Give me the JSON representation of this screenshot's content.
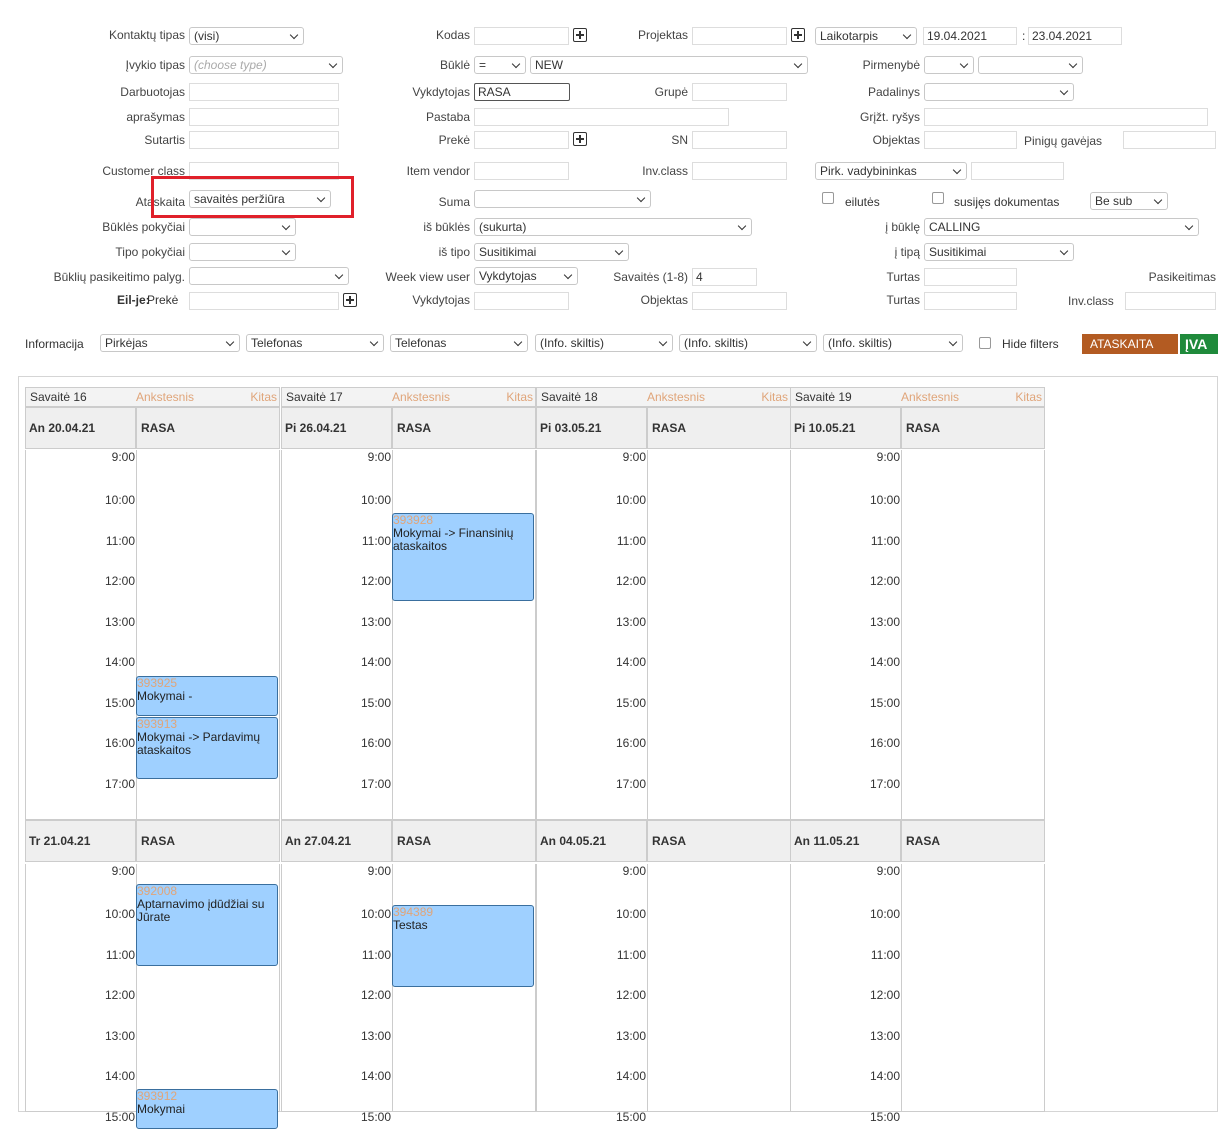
{
  "filters": {
    "kontaktu_tipas": {
      "label": "Kontaktų tipas",
      "value": "(visi)"
    },
    "ivykio_tipas": {
      "label": "Įvykio tipas",
      "placeholder": "(choose type)"
    },
    "darbuotojas": {
      "label": "Darbuotojas"
    },
    "aprasymas": {
      "label": "aprašymas"
    },
    "sutartis": {
      "label": "Sutartis"
    },
    "customer_class": {
      "label": "Customer class"
    },
    "ataskaita": {
      "label": "Ataskaita",
      "value": "savaitės peržiūra"
    },
    "bukles_pokyciai": {
      "label": "Būklės pokyčiai"
    },
    "tipo_pokyciai": {
      "label": "Tipo pokyčiai"
    },
    "bukliu_palyg": {
      "label": "Būklių pasikeitimo palyg."
    },
    "eilje": {
      "label": "Eil-je:",
      "sublabel": "Prekė"
    },
    "kodas": {
      "label": "Kodas"
    },
    "bukle": {
      "label": "Būklė",
      "operator": "=",
      "value": "NEW"
    },
    "vykdytojas": {
      "label": "Vykdytojas",
      "value": "RASA"
    },
    "pastaba": {
      "label": "Pastaba"
    },
    "preke": {
      "label": "Prekė"
    },
    "item_vendor": {
      "label": "Item vendor"
    },
    "suma": {
      "label": "Suma"
    },
    "is_bukles": {
      "label": "iš būklės",
      "value": "(sukurta)"
    },
    "is_tipo": {
      "label": "iš tipo",
      "value": "Susitikimai"
    },
    "week_view_user": {
      "label": "Week view user",
      "value": "Vykdytojas"
    },
    "vykdytojas2": {
      "label": "Vykdytojas"
    },
    "projektas": {
      "label": "Projektas"
    },
    "grupe": {
      "label": "Grupė"
    },
    "sn": {
      "label": "SN"
    },
    "inv_class": {
      "label": "Inv.class"
    },
    "savaites": {
      "label": "Savaitės (1-8)",
      "value": "4"
    },
    "objektas": {
      "label": "Objektas"
    },
    "laikotarpis": {
      "value": "Laikotarpis",
      "from": "19.04.2021",
      "sep": ":",
      "to": "23.04.2021"
    },
    "pirmenybe": {
      "label": "Pirmenybė"
    },
    "padalinys": {
      "label": "Padalinys"
    },
    "grizt_rysys": {
      "label": "Grįžt. ryšys"
    },
    "objektas_r": {
      "label": "Objektas"
    },
    "piniguGavejas": {
      "label": "Pinigų gavėjas"
    },
    "pirk_vadybininkas": {
      "value": "Pirk. vadybininkas"
    },
    "eilutes": {
      "label": "eilutės"
    },
    "susijes": {
      "label": "susijęs dokumentas",
      "value": "Be sub"
    },
    "i_bukle": {
      "label": "į būklę",
      "value": "CALLING"
    },
    "i_tipa": {
      "label": "į tipą",
      "value": "Susitikimai"
    },
    "turtas": {
      "label": "Turtas"
    },
    "pasikeitimas": {
      "label": "Pasikeitimas"
    },
    "turtas2": {
      "label": "Turtas"
    },
    "inv_class2": {
      "label": "Inv.class"
    }
  },
  "info_row": {
    "label": "Informacija",
    "selects": [
      "Pirkėjas",
      "Telefonas",
      "Telefonas",
      "(Info. skiltis)",
      "(Info. skiltis)",
      "(Info. skiltis)"
    ],
    "hide_filters": "Hide filters",
    "report_button": "ATASKAITA",
    "enter_button": "ĮVA",
    "colors": {
      "report": "#b35b22",
      "enter": "#1f8a3b",
      "highlight": "#e0202a"
    }
  },
  "calendar": {
    "nav_prev": "Ankstesnis",
    "nav_next": "Kitas",
    "weeks": [
      {
        "title": "Savaitė 16",
        "days": [
          {
            "date": "An 20.04.21",
            "user": "RASA",
            "times": [
              "9:00",
              "10:00",
              "11:00",
              "12:00",
              "13:00",
              "14:00",
              "15:00",
              "16:00",
              "17:00"
            ],
            "events": [
              {
                "id": "393925",
                "text": "Mokymai -"
              },
              {
                "id": "393913",
                "text": "Mokymai -> Pardavimų ataskaitos"
              }
            ]
          },
          {
            "date": "Tr 21.04.21",
            "user": "RASA",
            "times": [
              "9:00",
              "10:00",
              "11:00",
              "12:00",
              "13:00",
              "14:00",
              "15:00"
            ],
            "events": [
              {
                "id": "392008",
                "text": "Aptarnavimo įdūdžiai su Jūrate"
              },
              {
                "id": "393912",
                "text": "Mokymai"
              }
            ]
          }
        ]
      },
      {
        "title": "Savaitė 17",
        "days": [
          {
            "date": "Pi 26.04.21",
            "user": "RASA",
            "times": [
              "9:00",
              "10:00",
              "11:00",
              "12:00",
              "13:00",
              "14:00",
              "15:00",
              "16:00",
              "17:00"
            ],
            "events": [
              {
                "id": "393928",
                "text": "Mokymai -> Finansinių ataskaitos"
              }
            ]
          },
          {
            "date": "An 27.04.21",
            "user": "RASA",
            "times": [
              "9:00",
              "10:00",
              "11:00",
              "12:00",
              "13:00",
              "14:00",
              "15:00"
            ],
            "events": [
              {
                "id": "394389",
                "text": "Testas"
              }
            ]
          }
        ]
      },
      {
        "title": "Savaitė 18",
        "days": [
          {
            "date": "Pi 03.05.21",
            "user": "RASA",
            "times": [
              "9:00",
              "10:00",
              "11:00",
              "12:00",
              "13:00",
              "14:00",
              "15:00",
              "16:00",
              "17:00"
            ],
            "events": []
          },
          {
            "date": "An 04.05.21",
            "user": "RASA",
            "times": [
              "9:00",
              "10:00",
              "11:00",
              "12:00",
              "13:00",
              "14:00",
              "15:00"
            ],
            "events": []
          }
        ]
      },
      {
        "title": "Savaitė 19",
        "days": [
          {
            "date": "Pi 10.05.21",
            "user": "RASA",
            "times": [
              "9:00",
              "10:00",
              "11:00",
              "12:00",
              "13:00",
              "14:00",
              "15:00",
              "16:00",
              "17:00"
            ],
            "events": []
          },
          {
            "date": "An 11.05.21",
            "user": "RASA",
            "times": [
              "9:00",
              "10:00",
              "11:00",
              "12:00",
              "13:00",
              "14:00",
              "15:00"
            ],
            "events": []
          }
        ]
      }
    ]
  }
}
